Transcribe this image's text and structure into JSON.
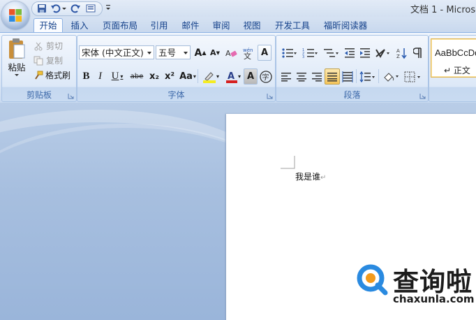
{
  "window": {
    "title": "文档 1 - Microso"
  },
  "quick_access": {
    "icons": [
      "save-icon",
      "undo-icon",
      "redo-icon",
      "print-preview-icon",
      "customize-menu-icon"
    ]
  },
  "tabs": [
    {
      "label": "开始",
      "active": true
    },
    {
      "label": "插入"
    },
    {
      "label": "页面布局"
    },
    {
      "label": "引用"
    },
    {
      "label": "邮件"
    },
    {
      "label": "审阅"
    },
    {
      "label": "视图"
    },
    {
      "label": "开发工具"
    },
    {
      "label": "福昕阅读器"
    }
  ],
  "ribbon": {
    "clipboard": {
      "label": "剪贴板",
      "paste": "粘贴",
      "cut": "剪切",
      "copy": "复制",
      "format_painter": "格式刷"
    },
    "font": {
      "label": "字体",
      "font_name": "宋体 (中文正文)",
      "font_size": "五号",
      "bold": "B",
      "italic": "I",
      "underline": "U",
      "strikethrough": "abe",
      "subscript": "x₂",
      "superscript": "x²",
      "change_case": "Aa",
      "grow": "A",
      "shrink": "A",
      "char_border": "A",
      "char_shading": "A",
      "phonetic": "wén",
      "enclose": "字"
    },
    "paragraph": {
      "label": "段落"
    },
    "styles": {
      "sample": "AaBbCcDd",
      "name": "↵ 正文"
    }
  },
  "document": {
    "text": "我是谁",
    "paragraph_mark": "↵"
  },
  "watermark": {
    "cn": "查询啦",
    "en": "chaxunla.com"
  },
  "colors": {
    "accent": "#15428b",
    "ribbon_bg": "#dfe9f7",
    "workspace_bg": "#a7bfdf",
    "highlight": "#f6c55a",
    "font_color": "#d62020",
    "watermark_blue": "#2a8ae0",
    "watermark_orange": "#f39a1c"
  }
}
